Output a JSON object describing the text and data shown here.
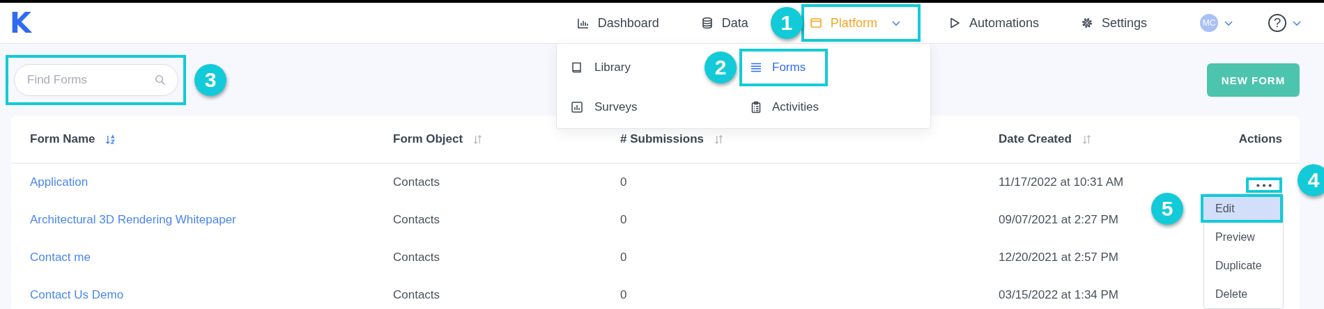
{
  "logo": {
    "text": "K"
  },
  "nav": [
    {
      "label": "Dashboard",
      "kind": "chart",
      "selected": false
    },
    {
      "label": "Data",
      "kind": "database",
      "selected": false
    },
    {
      "label": "Platform",
      "kind": "window",
      "selected": true,
      "callout": "1"
    },
    {
      "label": "Automations",
      "kind": "play",
      "selected": false
    },
    {
      "label": "Settings",
      "kind": "gear",
      "selected": false
    }
  ],
  "account": {
    "initials": "MC"
  },
  "help": {
    "symbol": "?"
  },
  "platform_menu": {
    "items": [
      {
        "label": "Library",
        "kind": "book",
        "selected": false
      },
      {
        "label": "Forms",
        "kind": "list",
        "selected": true,
        "callout": "2"
      },
      {
        "label": "Surveys",
        "kind": "report",
        "selected": false
      },
      {
        "label": "Activities",
        "kind": "clipboard",
        "selected": false
      }
    ]
  },
  "search": {
    "placeholder": "Find Forms",
    "callout": "3"
  },
  "new_form_button": "NEW FORM",
  "table": {
    "columns": [
      {
        "label": "Form Name",
        "sorted": true
      },
      {
        "label": "Form Object",
        "sorted": false
      },
      {
        "label": "# Submissions",
        "sorted": false
      },
      {
        "label": "Date Created",
        "sorted": false
      },
      {
        "label": "Actions"
      }
    ],
    "rows": [
      {
        "cells": [
          "Application",
          "Contacts",
          "0",
          "11/17/2022 at 10:31 AM"
        ]
      },
      {
        "cells": [
          "Architectural 3D Rendering Whitepaper",
          "Contacts",
          "0",
          "09/07/2021 at 2:27 PM"
        ]
      },
      {
        "cells": [
          "Contact me",
          "Contacts",
          "0",
          "12/20/2021 at 2:57 PM"
        ]
      },
      {
        "cells": [
          "Contact Us Demo",
          "Contacts",
          "0",
          "03/15/2022 at 1:34 PM"
        ]
      }
    ]
  },
  "row_menu": {
    "callout": "4",
    "items": [
      {
        "label": "Edit",
        "selected": true,
        "callout": "5"
      },
      {
        "label": "Preview",
        "selected": false
      },
      {
        "label": "Duplicate",
        "selected": false
      },
      {
        "label": "Delete",
        "selected": false
      }
    ]
  }
}
